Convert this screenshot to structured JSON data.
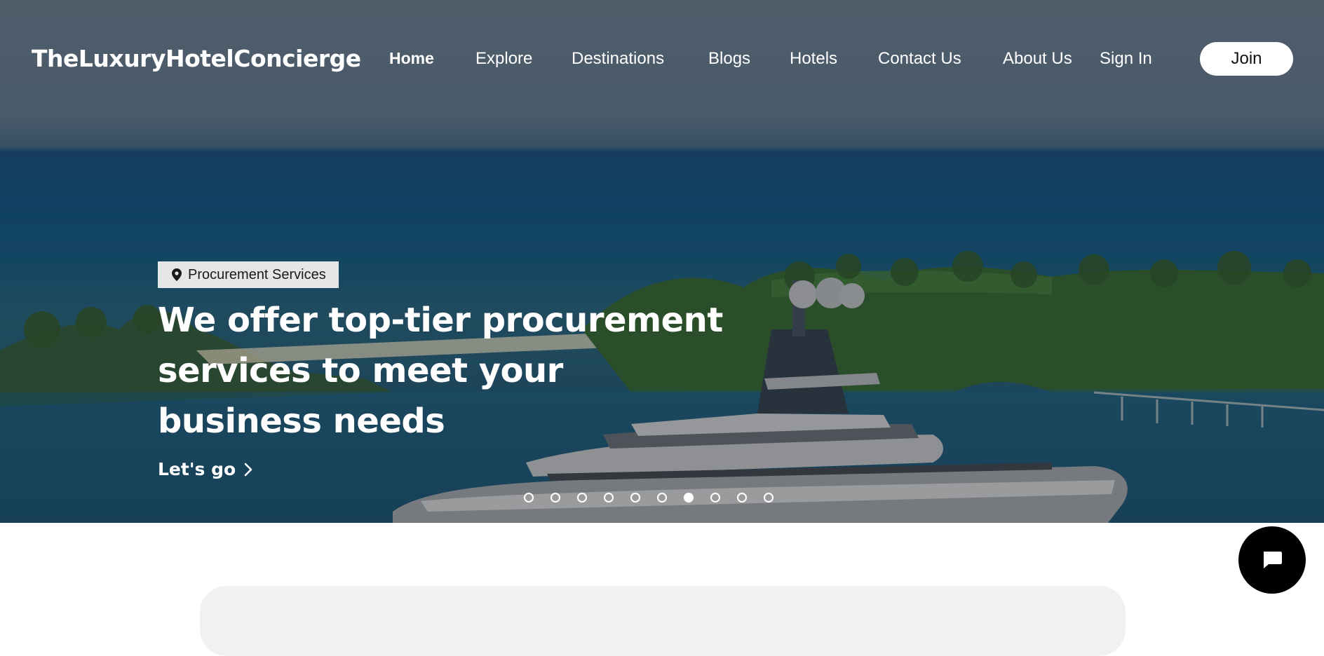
{
  "header": {
    "logo": "TheLuxuryHotelConcierge",
    "nav": [
      {
        "label": "Home",
        "active": true
      },
      {
        "label": "Explore",
        "active": false
      },
      {
        "label": "Destinations",
        "active": false
      },
      {
        "label": "Blogs",
        "active": false
      },
      {
        "label": "Hotels",
        "active": false
      },
      {
        "label": "Contact Us",
        "active": false
      },
      {
        "label": "About Us",
        "active": false
      }
    ],
    "sign_in": "Sign In",
    "join": "Join"
  },
  "hero": {
    "tag_icon": "map-pin-icon",
    "tag": "Procurement Services",
    "headline": "We offer top-tier procurement services to meet your business needs",
    "cta": "Let's go",
    "cta_icon": "chevron-right-icon",
    "carousel": {
      "total": 10,
      "active_index": 7
    }
  },
  "chat": {
    "icon": "chat-bubble-icon"
  },
  "colors": {
    "text_on_hero": "#ffffff",
    "tag_bg": "#e4e6e7",
    "join_bg": "#ffffff",
    "chat_bg": "#000000",
    "card_bg": "#f1f1f1"
  }
}
